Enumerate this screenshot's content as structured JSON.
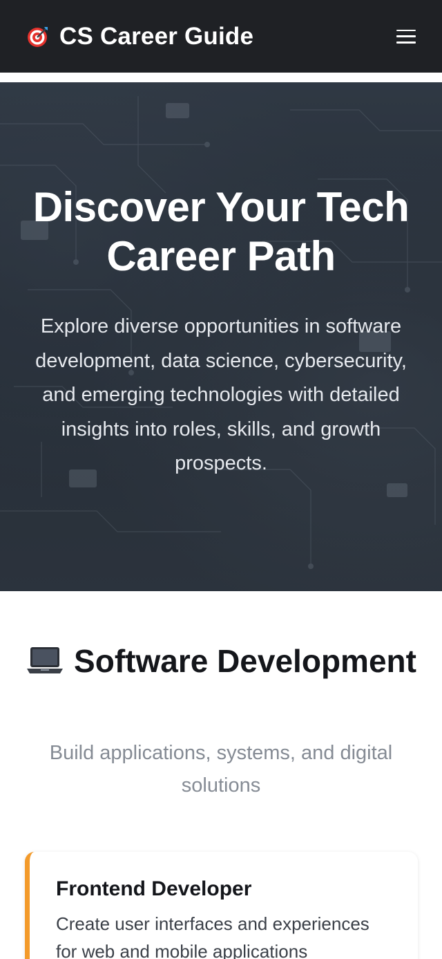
{
  "header": {
    "brand_title": "CS Career Guide",
    "brand_icon": "target-icon",
    "menu_icon": "hamburger-menu-icon"
  },
  "hero": {
    "title": "Discover Your Tech Career Path",
    "subtitle": "Explore diverse opportunities in software development, data science, cybersecurity, and emerging technologies with detailed insights into roles, skills, and growth prospects."
  },
  "section": {
    "icon": "laptop-icon",
    "title": "Software Development",
    "subtitle": "Build applications, systems, and digital solutions"
  },
  "cards": [
    {
      "title": "Frontend Developer",
      "description": "Create user interfaces and experiences for web and mobile applications",
      "accent": "#f39a2a"
    }
  ],
  "colors": {
    "header_bg": "#1f2125",
    "accent": "#f39a2a",
    "text_dark": "#14161b",
    "text_muted": "#858b94"
  }
}
